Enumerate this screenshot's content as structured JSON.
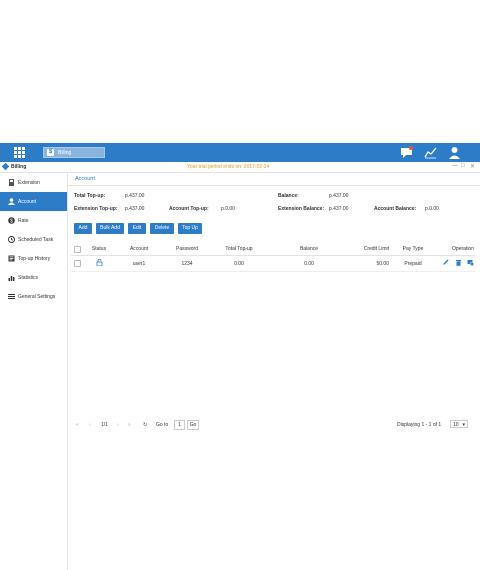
{
  "topbar": {
    "app_tab_label": "Billing"
  },
  "window": {
    "title": "Billing",
    "trial_notice": "Your trial period ends on: 2017-02-24"
  },
  "sidebar": {
    "items": [
      {
        "label": "Extension"
      },
      {
        "label": "Account"
      },
      {
        "label": "Rate"
      },
      {
        "label": "Scheduled Task"
      },
      {
        "label": "Top-up History"
      },
      {
        "label": "Statistics"
      },
      {
        "label": "General Settings"
      }
    ]
  },
  "main": {
    "tab_label": "Account",
    "stats": {
      "total_topup_label": "Total Top-up:",
      "total_topup_value": "p.437.00",
      "balance_label": "Balance:",
      "balance_value": "p.437.00",
      "ext_topup_label": "Extension Top-up:",
      "ext_topup_value": "p.437.00",
      "acct_topup_label": "Account Top-up:",
      "acct_topup_value": "p.0.00",
      "ext_balance_label": "Extension Balance:",
      "ext_balance_value": "p.437.00",
      "acct_balance_label": "Account Balance:",
      "acct_balance_value": "p.0.00"
    },
    "buttons": {
      "add": "Add",
      "bulk_add": "Bulk Add",
      "edit": "Edit",
      "delete": "Delete",
      "top_up": "Top Up"
    },
    "table": {
      "headers": [
        "Status",
        "Account",
        "Password",
        "Total Top-up",
        "Balance",
        "Credit Limit",
        "Pay Type",
        "Operation"
      ],
      "rows": [
        {
          "account": "user1",
          "password": "1234",
          "total_topup": "0.00",
          "balance": "0.00",
          "credit_limit": "50.00",
          "pay_type": "Prepaid"
        }
      ]
    },
    "pager": {
      "page_info": "1/1",
      "goto_label": "Go to",
      "goto_value": "1",
      "go_button": "Go",
      "displaying": "Displaying 1 - 1 of 1",
      "page_size": "10"
    }
  },
  "colors": {
    "primary": "#2d7cc8",
    "trial": "#e89b1c"
  }
}
